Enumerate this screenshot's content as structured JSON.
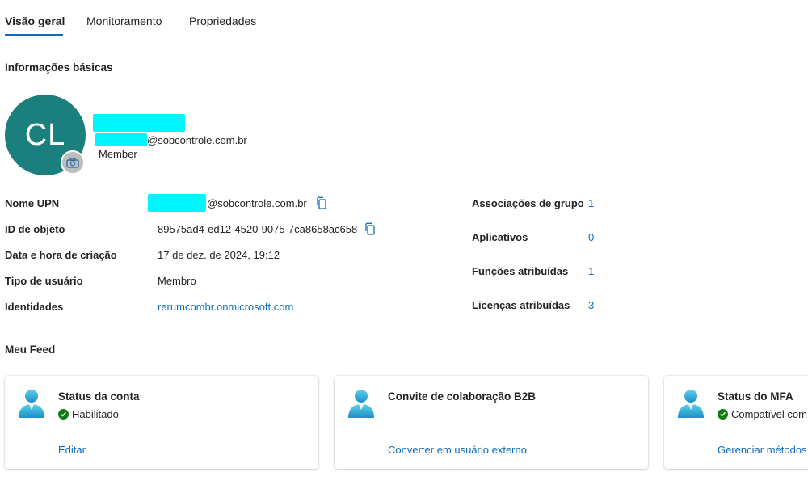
{
  "tabs": [
    {
      "label": "Visão geral"
    },
    {
      "label": "Monitoramento"
    },
    {
      "label": "Propriedades"
    }
  ],
  "basic_info": {
    "title": "Informações básicas",
    "initials": "CL",
    "email_suffix": "@sobcontrole.com.br",
    "member_type": "Member"
  },
  "properties": {
    "upn": {
      "label": "Nome UPN",
      "suffix": "@sobcontrole.com.br"
    },
    "object_id": {
      "label": "ID de objeto",
      "value": "89575ad4-ed12-4520-9075-7ca8658ac658"
    },
    "created": {
      "label": "Data e hora de criação",
      "value": "17 de dez. de 2024, 19:12"
    },
    "user_type": {
      "label": "Tipo de usuário",
      "value": "Membro"
    },
    "identities": {
      "label": "Identidades",
      "value": "rerumcombr.onmicrosoft.com"
    }
  },
  "stats": [
    {
      "label": "Associações de grupo",
      "value": "1"
    },
    {
      "label": "Aplicativos",
      "value": "0"
    },
    {
      "label": "Funções atribuídas",
      "value": "1"
    },
    {
      "label": "Licenças atribuídas",
      "value": "3"
    }
  ],
  "feed": {
    "title": "Meu Feed",
    "cards": [
      {
        "title": "Status da conta",
        "status": "Habilitado",
        "link": "Editar"
      },
      {
        "title": "Convite de colaboração B2B",
        "status": "",
        "link": "Converter em usuário externo"
      },
      {
        "title": "Status do MFA",
        "status": "Compatível com",
        "link": "Gerenciar métodos"
      }
    ]
  },
  "colors": {
    "accent": "#0f6cbd",
    "avatar": "#1b7f7d",
    "success": "#107c10",
    "redaction": "#00f5ff"
  }
}
